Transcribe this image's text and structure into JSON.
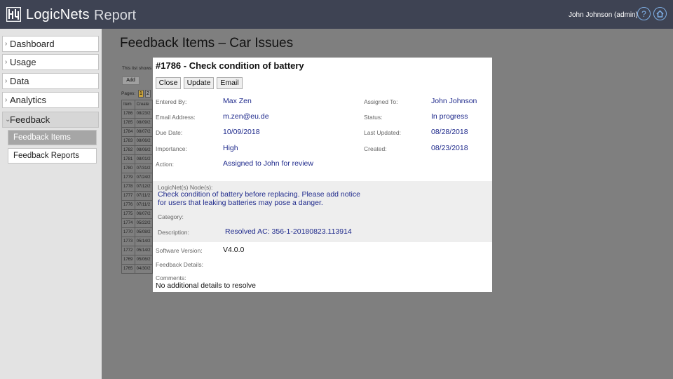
{
  "header": {
    "brand": "LogicNets",
    "app_title": "Report",
    "user": "John Johnson (admin)",
    "help_icon": "help-icon",
    "home_icon": "home-icon"
  },
  "sidebar": {
    "items": [
      {
        "label": "Dashboard"
      },
      {
        "label": "Usage"
      },
      {
        "label": "Data"
      },
      {
        "label": "Analytics"
      },
      {
        "label": "Feedback"
      }
    ],
    "sub_items": [
      {
        "label": "Feedback Items"
      },
      {
        "label": "Feedback Reports"
      }
    ]
  },
  "main": {
    "title": "Feedback Items – Car Issues",
    "list_info": "This list shows",
    "add_label": "Add",
    "pages_label": "Pages:",
    "pages": [
      "1",
      "2"
    ],
    "table_headers": [
      "Item",
      "Create"
    ],
    "rows": [
      [
        "1786",
        "08/23/2"
      ],
      [
        "1785",
        "08/09/2"
      ],
      [
        "1784",
        "08/07/2"
      ],
      [
        "1783",
        "08/06/2"
      ],
      [
        "1782",
        "08/06/2"
      ],
      [
        "1781",
        "08/01/2"
      ],
      [
        "1780",
        "07/31/2"
      ],
      [
        "1779",
        "07/24/2"
      ],
      [
        "1778",
        "07/12/2"
      ],
      [
        "1777",
        "07/11/2"
      ],
      [
        "1776",
        "07/11/2"
      ],
      [
        "1775",
        "06/07/2"
      ],
      [
        "1774",
        "05/22/2"
      ],
      [
        "1770",
        "05/08/2"
      ],
      [
        "1773",
        "05/14/2"
      ],
      [
        "1772",
        "05/14/2"
      ],
      [
        "1769",
        "05/06/2"
      ],
      [
        "1765",
        "04/30/2"
      ]
    ]
  },
  "modal": {
    "title": "#1786 - Check condition of battery",
    "buttons": {
      "close": "Close",
      "update": "Update",
      "email": "Email"
    },
    "entered_by_label": "Entered By:",
    "entered_by": "Max Zen",
    "email_label": "Email Address:",
    "email": "m.zen@eu.de",
    "due_label": "Due Date:",
    "due": "10/09/2018",
    "importance_label": "Importance:",
    "importance": "High",
    "action_label": "Action:",
    "action": "Assigned to John for review",
    "assigned_label": "Assigned To:",
    "assigned": "John Johnson",
    "status_label": "Status:",
    "status": "In progress",
    "updated_label": "Last Updated:",
    "updated": "08/28/2018",
    "created_label": "Created:",
    "created": "08/23/2018",
    "nodes_label": "LogicNet(s) Node(s):",
    "nodes_line1": "Check condition of battery before replacing. Please add notice",
    "nodes_line2": "for users that leaking batteries may pose a danger.",
    "category_label": "Category:",
    "description_label": "Description:",
    "description": "Resolved AC: 356-1-20180823.113914",
    "software_label": "Software Version:",
    "software": "V4.0.0",
    "details_label": "Feedback Details:",
    "comments_label": "Comments:",
    "comments": "No additional details to resolve"
  }
}
